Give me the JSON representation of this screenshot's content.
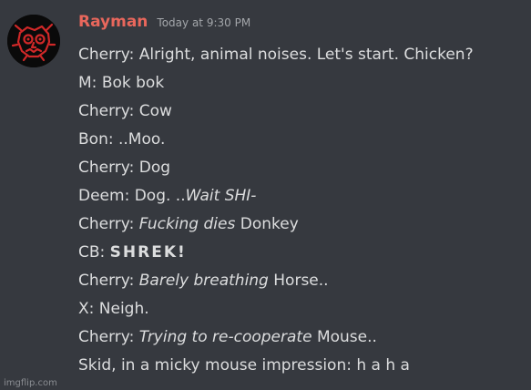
{
  "message": {
    "username": "Rayman",
    "timestamp": "Today at 9:30 PM",
    "colors": {
      "background": "#36393f",
      "username": "#e9675c",
      "text": "#dcddde",
      "timestamp": "#a3a6aa"
    },
    "avatar": {
      "icon": "red-skull-avatar-icon"
    },
    "lines": [
      {
        "speaker": "Cherry:",
        "plain1": "Alright, animal noises. Let's start. Chicken?",
        "italic": "",
        "plain2": "",
        "bold": ""
      },
      {
        "speaker": "M:",
        "plain1": "Bok bok",
        "italic": "",
        "plain2": "",
        "bold": ""
      },
      {
        "speaker": "Cherry:",
        "plain1": "Cow",
        "italic": "",
        "plain2": "",
        "bold": ""
      },
      {
        "speaker": "Bon:",
        "plain1": "..Moo.",
        "italic": "",
        "plain2": "",
        "bold": ""
      },
      {
        "speaker": "Cherry:",
        "plain1": "Dog",
        "italic": "",
        "plain2": "",
        "bold": ""
      },
      {
        "speaker": "Deem:",
        "plain1": "Dog. ..",
        "italic": "Wait SHI-",
        "plain2": "",
        "bold": ""
      },
      {
        "speaker": "Cherry:",
        "plain1": "",
        "italic": "Fucking dies",
        "plain2": "Donkey",
        "bold": ""
      },
      {
        "speaker": "CB:",
        "plain1": "",
        "italic": "",
        "plain2": "",
        "bold": "SHREK!"
      },
      {
        "speaker": "Cherry:",
        "plain1": "",
        "italic": "Barely breathing",
        "plain2": "Horse..",
        "bold": ""
      },
      {
        "speaker": "X:",
        "plain1": "Neigh.",
        "italic": "",
        "plain2": "",
        "bold": ""
      },
      {
        "speaker": "Cherry:",
        "plain1": "",
        "italic": "Trying to re-cooperate",
        "plain2": "Mouse..",
        "bold": ""
      },
      {
        "speaker": "Skid, in a micky mouse impression:",
        "plain1": "h a h a",
        "italic": "",
        "plain2": "",
        "bold": ""
      }
    ]
  },
  "watermark": "imgflip.com"
}
